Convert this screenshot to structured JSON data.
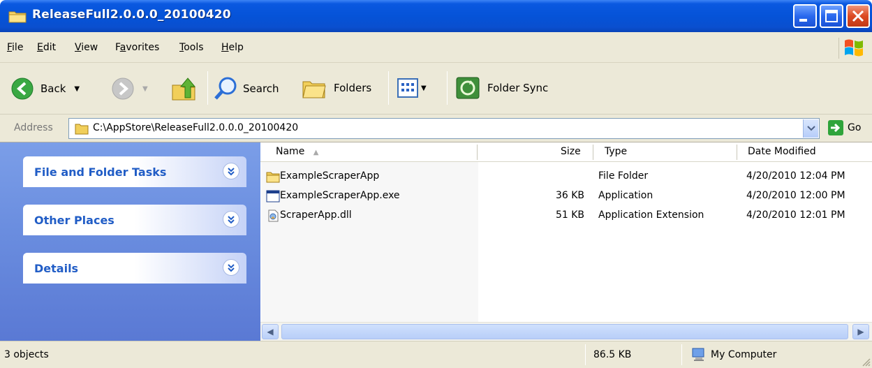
{
  "window": {
    "title": "ReleaseFull2.0.0.0_20100420"
  },
  "menu": [
    {
      "label": "File",
      "u": "F",
      "rest": "ile"
    },
    {
      "label": "Edit",
      "u": "E",
      "rest": "dit"
    },
    {
      "label": "View",
      "u": "V",
      "rest": "iew"
    },
    {
      "label": "Favorites",
      "pre": "F",
      "u": "a",
      "rest": "vorites"
    },
    {
      "label": "Tools",
      "u": "T",
      "rest": "ools"
    },
    {
      "label": "Help",
      "u": "H",
      "rest": "elp"
    }
  ],
  "toolbar": {
    "back_label": "Back",
    "search_label": "Search",
    "folders_label": "Folders",
    "sync_label": "Folder Sync"
  },
  "address": {
    "label": "Address",
    "path": "C:\\AppStore\\ReleaseFull2.0.0.0_20100420",
    "go_label": "Go"
  },
  "tasks": {
    "panels": [
      "File and Folder Tasks",
      "Other Places",
      "Details"
    ]
  },
  "columns": {
    "name": "Name",
    "size": "Size",
    "type": "Type",
    "date": "Date Modified"
  },
  "files": [
    {
      "name": "ExampleScraperApp",
      "size": "",
      "type": "File Folder",
      "date": "4/20/2010 12:04 PM",
      "icon": "folder-icon"
    },
    {
      "name": "ExampleScraperApp.exe",
      "size": "36 KB",
      "type": "Application",
      "date": "4/20/2010 12:00 PM",
      "icon": "application-icon"
    },
    {
      "name": "ScraperApp.dll",
      "size": "51 KB",
      "type": "Application Extension",
      "date": "4/20/2010 12:01 PM",
      "icon": "dll-icon"
    }
  ],
  "status": {
    "objects": "3 objects",
    "size": "86.5 KB",
    "location": "My Computer"
  }
}
